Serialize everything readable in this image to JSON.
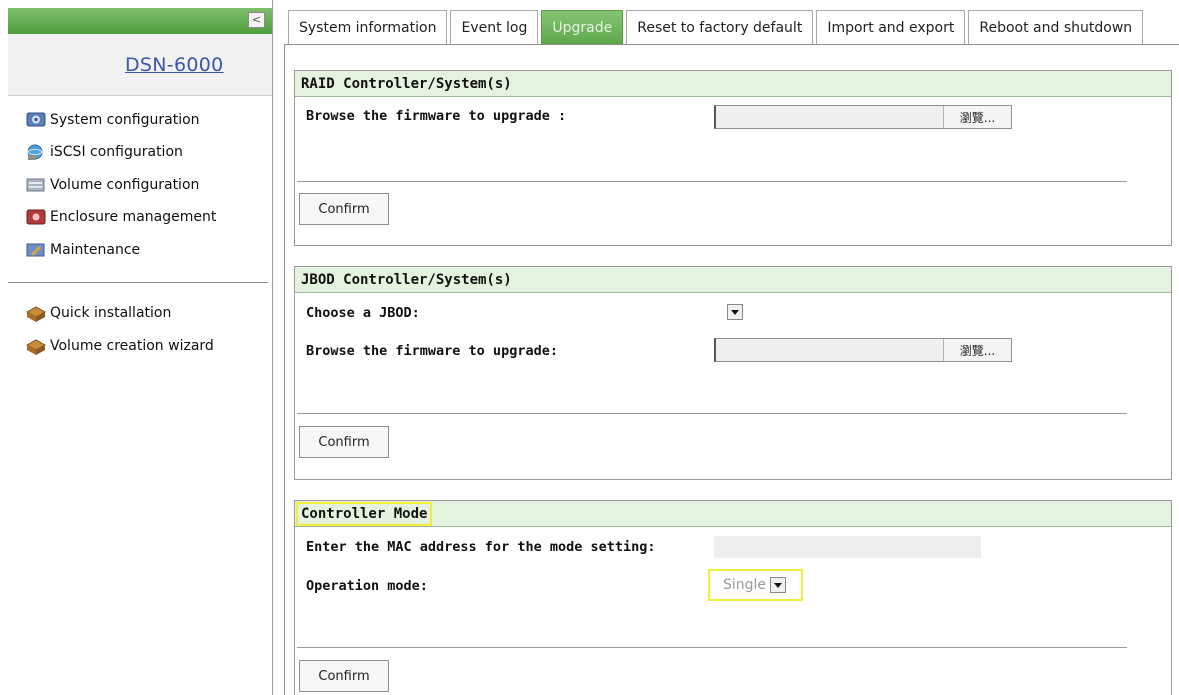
{
  "sidebar": {
    "collapse_glyph": "<",
    "logo": "DSN-6000",
    "primary_items": [
      {
        "label": "System configuration",
        "icon": "system-config-icon"
      },
      {
        "label": "iSCSI configuration",
        "icon": "iscsi-config-icon"
      },
      {
        "label": "Volume configuration",
        "icon": "volume-config-icon"
      },
      {
        "label": "Enclosure management",
        "icon": "enclosure-icon"
      },
      {
        "label": "Maintenance",
        "icon": "maintenance-icon"
      }
    ],
    "secondary_items": [
      {
        "label": "Quick installation",
        "icon": "quick-install-icon"
      },
      {
        "label": "Volume creation wizard",
        "icon": "wizard-icon"
      }
    ]
  },
  "tabs": [
    {
      "label": "System information",
      "active": false
    },
    {
      "label": "Event log",
      "active": false
    },
    {
      "label": "Upgrade",
      "active": true
    },
    {
      "label": "Reset to factory default",
      "active": false
    },
    {
      "label": "Import and export",
      "active": false
    },
    {
      "label": "Reboot and shutdown",
      "active": false
    }
  ],
  "raid_section": {
    "title": "RAID Controller/System(s)",
    "browse_label": "Browse the firmware to upgrade :",
    "browse_button": "瀏覽...",
    "file_value": "",
    "confirm": "Confirm"
  },
  "jbod_section": {
    "title": "JBOD Controller/System(s)",
    "choose_label": "Choose a JBOD:",
    "jbod_selected": "",
    "browse_label": "Browse the firmware to upgrade:",
    "browse_button": "瀏覽...",
    "file_value": "",
    "confirm": "Confirm"
  },
  "controller_section": {
    "title": "Controller Mode",
    "mac_label": "Enter the MAC address for the mode setting:",
    "mac_value": "",
    "operation_label": "Operation mode:",
    "operation_value": "Single",
    "confirm": "Confirm"
  },
  "colors": {
    "header_green": "#5ea84b",
    "section_header_bg": "#e4f2df",
    "highlight_yellow": "#f2ee3d",
    "logo_blue": "#3a57a8"
  }
}
